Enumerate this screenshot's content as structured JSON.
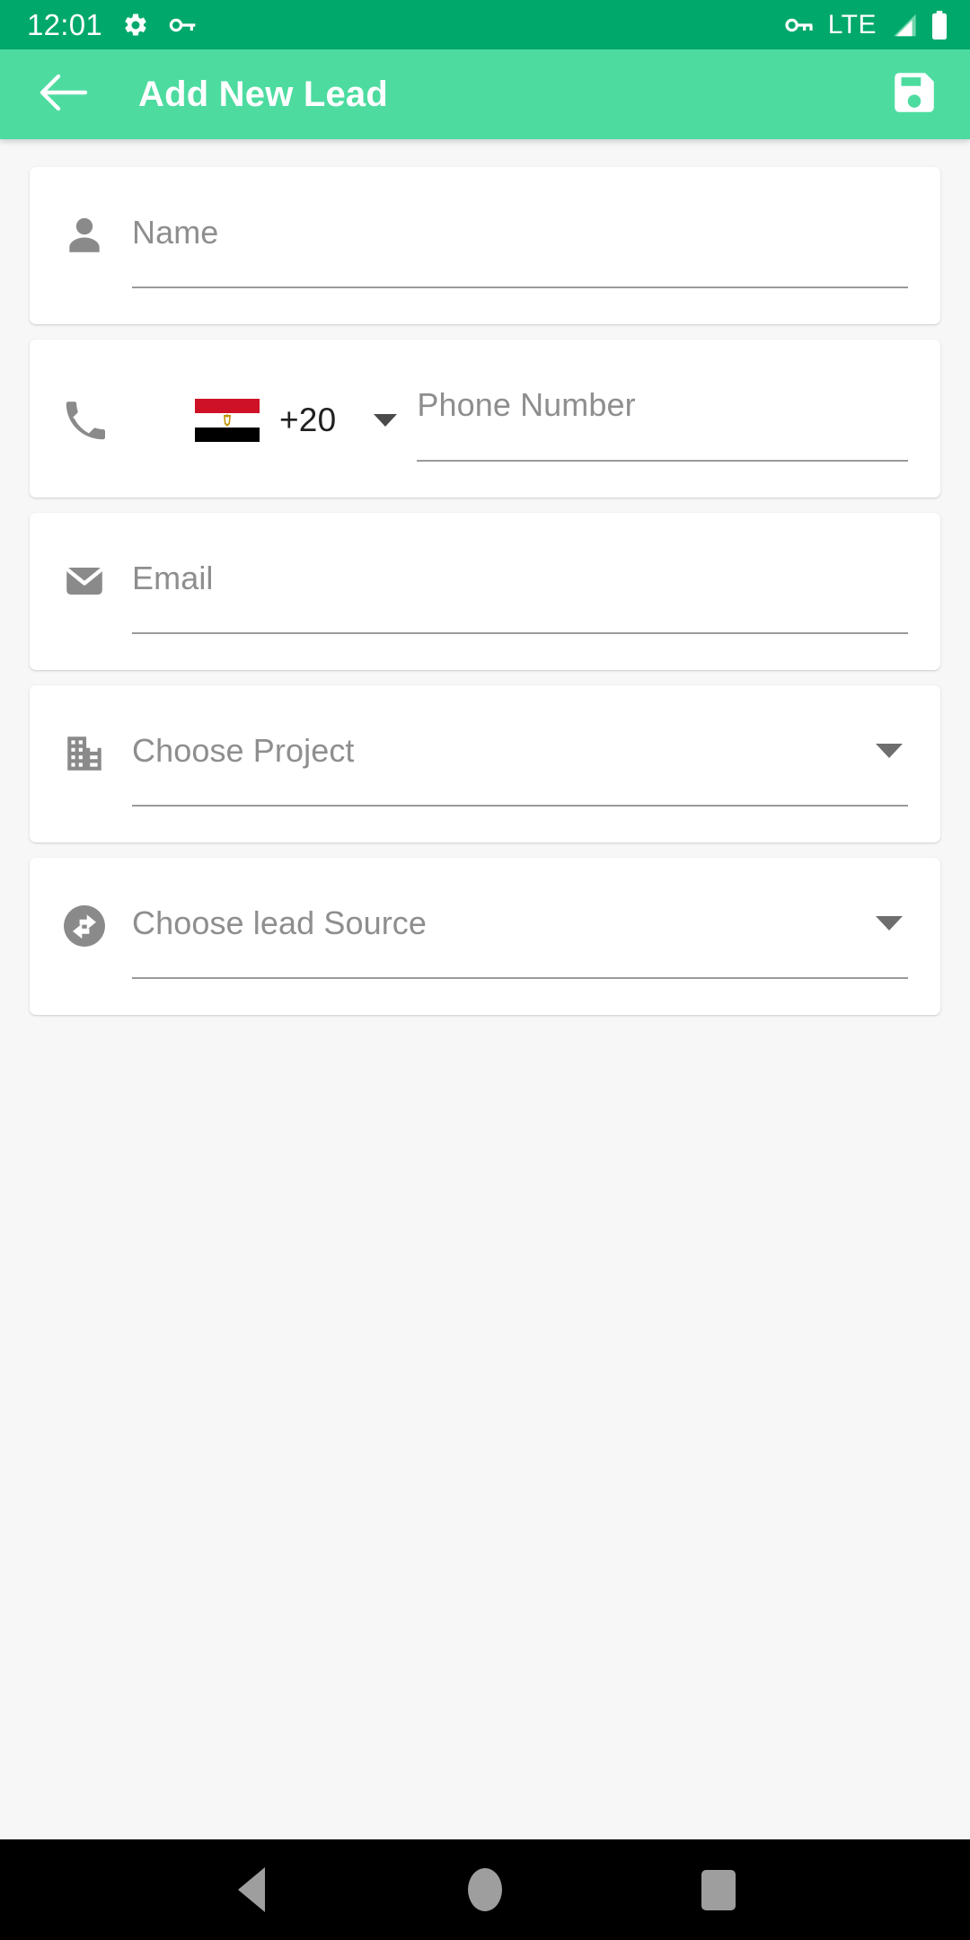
{
  "status_bar": {
    "clock": "12:01",
    "left_icons": [
      "gear-icon",
      "key-icon"
    ],
    "network_label": "LTE",
    "right_icons": [
      "vpn-key-icon",
      "signal-icon",
      "battery-icon"
    ],
    "background_color": "#00a86b",
    "foreground_color": "#ffffff"
  },
  "appbar": {
    "title": "Add New Lead",
    "back_icon": "arrow-back-icon",
    "save_icon": "save-floppy-icon",
    "background_color": "#4ddba0",
    "title_color": "#ffffff"
  },
  "form": {
    "fields": [
      {
        "key": "name",
        "icon": "person-icon",
        "placeholder": "Name",
        "value": "",
        "type": "text"
      },
      {
        "key": "phone",
        "icon": "phone-icon",
        "placeholder": "Phone Number",
        "value": "",
        "type": "phone",
        "country_flag": "egypt-flag-icon",
        "dial_code": "+20"
      },
      {
        "key": "email",
        "icon": "email-icon",
        "placeholder": "Email",
        "value": "",
        "type": "email"
      },
      {
        "key": "project",
        "icon": "building-icon",
        "placeholder": "Choose Project",
        "value": "",
        "type": "dropdown"
      },
      {
        "key": "lead_source",
        "icon": "compare-arrows-icon",
        "placeholder": "Choose lead Source",
        "value": "",
        "type": "dropdown"
      }
    ],
    "placeholder_color": "#8e8e8e",
    "underline_color": "#9a9a9a",
    "card_background": "#ffffff",
    "page_background": "#f7f7f7"
  },
  "navbar": {
    "background_color": "#000000",
    "icon_color": "#9e9e9e",
    "buttons": [
      {
        "key": "back",
        "icon": "nav-back-triangle-icon"
      },
      {
        "key": "home",
        "icon": "nav-home-circle-icon"
      },
      {
        "key": "recents",
        "icon": "nav-recents-square-icon"
      }
    ]
  }
}
